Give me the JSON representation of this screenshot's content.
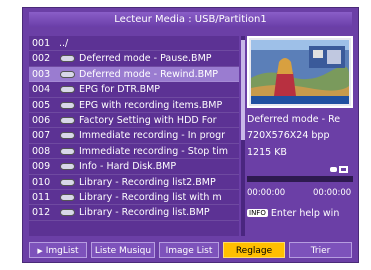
{
  "title": "Lecteur Media  : USB/Partition1",
  "files": [
    {
      "num": "001",
      "name": "../",
      "icon": "none"
    },
    {
      "num": "002",
      "name": "Deferred mode - Pause.BMP",
      "icon": "bmp-icon"
    },
    {
      "num": "003",
      "name": "Deferred mode - Rewind.BMP",
      "icon": "bmp-icon",
      "selected": true
    },
    {
      "num": "004",
      "name": "EPG for DTR.BMP",
      "icon": "bmp-icon"
    },
    {
      "num": "005",
      "name": "EPG with recording items.BMP",
      "icon": "bmp-icon"
    },
    {
      "num": "006",
      "name": "Factory Setting with HDD For",
      "icon": "bmp-icon"
    },
    {
      "num": "007",
      "name": "Immediate recording - In progr",
      "icon": "bmp-icon"
    },
    {
      "num": "008",
      "name": "Immediate recording - Stop tim",
      "icon": "bmp-icon"
    },
    {
      "num": "009",
      "name": "Info - Hard Disk.BMP",
      "icon": "bmp-icon"
    },
    {
      "num": "010",
      "name": "Library - Recording list2.BMP",
      "icon": "bmp-icon"
    },
    {
      "num": "011",
      "name": "Library - Recording list with m",
      "icon": "bmp-icon"
    },
    {
      "num": "012",
      "name": "Library - Recording list.BMP",
      "icon": "bmp-icon"
    }
  ],
  "preview": {
    "filename": "Deferred mode - Re",
    "resolution": "720X576X24 bpp",
    "size": "1215 KB",
    "icon": "media-type-icon"
  },
  "playback": {
    "time_start": "00:00:00",
    "time_end": "00:00:00",
    "progress": 0
  },
  "help": {
    "key": "INFO",
    "text": "Enter help win"
  },
  "buttons": [
    {
      "label": "ImgList",
      "icon": "play-arrow-icon"
    },
    {
      "label": "Liste Musiqu"
    },
    {
      "label": "Image List"
    },
    {
      "label": "Reglage",
      "active": true
    },
    {
      "label": "Trier"
    }
  ],
  "colors": {
    "background": "#6b3fa6",
    "selected_row": "#9a7cd0",
    "active_button": "#ffbf00"
  }
}
